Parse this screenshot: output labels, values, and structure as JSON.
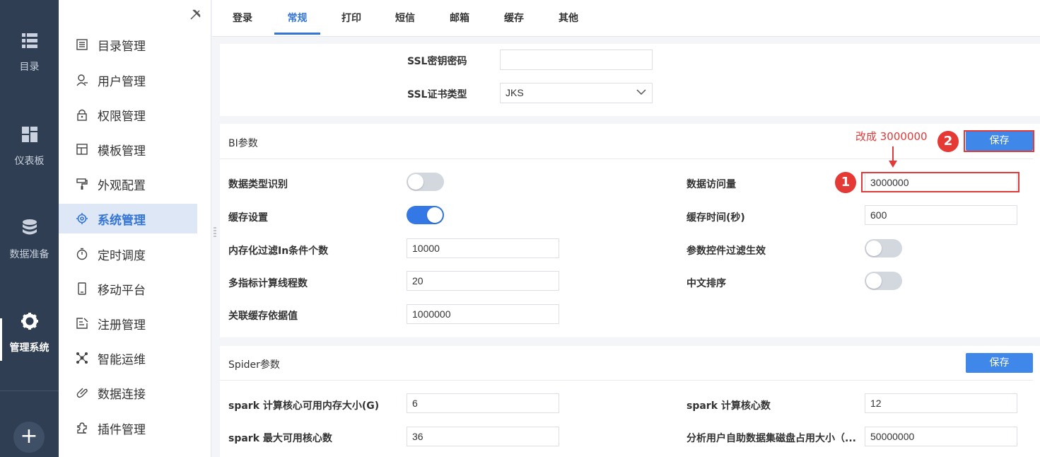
{
  "rail": {
    "items": [
      {
        "label": "目录",
        "icon": "list-icon"
      },
      {
        "label": "仪表板",
        "icon": "dashboard-icon"
      },
      {
        "label": "数据准备",
        "icon": "database-icon"
      },
      {
        "label": "管理系统",
        "icon": "gear-icon"
      }
    ],
    "add_symbol": "+"
  },
  "menu": {
    "items": [
      {
        "label": "目录管理",
        "icon": "catalog-icon"
      },
      {
        "label": "用户管理",
        "icon": "user-icon"
      },
      {
        "label": "权限管理",
        "icon": "lock-icon"
      },
      {
        "label": "模板管理",
        "icon": "template-icon"
      },
      {
        "label": "外观配置",
        "icon": "paint-roller-icon"
      },
      {
        "label": "系统管理",
        "icon": "settings-icon"
      },
      {
        "label": "定时调度",
        "icon": "timer-icon"
      },
      {
        "label": "移动平台",
        "icon": "mobile-icon"
      },
      {
        "label": "注册管理",
        "icon": "register-icon"
      },
      {
        "label": "智能运维",
        "icon": "ops-icon"
      },
      {
        "label": "数据连接",
        "icon": "link-icon"
      },
      {
        "label": "插件管理",
        "icon": "plugin-icon"
      }
    ],
    "active_index": 5
  },
  "tabs": [
    "登录",
    "常规",
    "打印",
    "短信",
    "邮箱",
    "缓存",
    "其他"
  ],
  "active_tab": "常规",
  "ssl": {
    "key_password_label": "SSL密钥密码",
    "key_password_value": "",
    "cert_type_label": "SSL证书类型",
    "cert_type_value": "JKS"
  },
  "bi": {
    "title": "BI参数",
    "save_label": "保存",
    "data_type_label": "数据类型识别",
    "data_type_on": false,
    "cache_label": "缓存设置",
    "cache_on": true,
    "in_filter_label": "内存化过滤In条件个数",
    "in_filter_value": "10000",
    "threads_label": "多指标计算线程数",
    "threads_value": "20",
    "assoc_label": "关联缓存依据值",
    "assoc_value": "1000000",
    "access_label": "数据访问量",
    "access_value": "3000000",
    "cache_time_label": "缓存时间(秒)",
    "cache_time_value": "600",
    "param_filter_label": "参数控件过滤生效",
    "param_filter_on": false,
    "cn_sort_label": "中文排序",
    "cn_sort_on": false
  },
  "spider": {
    "title": "Spider参数",
    "save_label": "保存",
    "mem_label": "spark 计算核心可用内存大小(G)",
    "mem_value": "6",
    "cores_label": "spark 计算核心数",
    "cores_value": "12",
    "max_cores_label": "spark 最大可用核心数",
    "max_cores_value": "36",
    "disk_label": "分析用户自助数据集磁盘占用大小（...",
    "disk_value": "50000000"
  },
  "annotations": {
    "badge1": "1",
    "badge2": "2",
    "note": "改成 3000000",
    "color": "#e03a3a"
  },
  "colors": {
    "rail_bg": "#2f3e52",
    "accent": "#3475d6",
    "button": "#3f87e8",
    "toggle_on": "#3478e5"
  }
}
